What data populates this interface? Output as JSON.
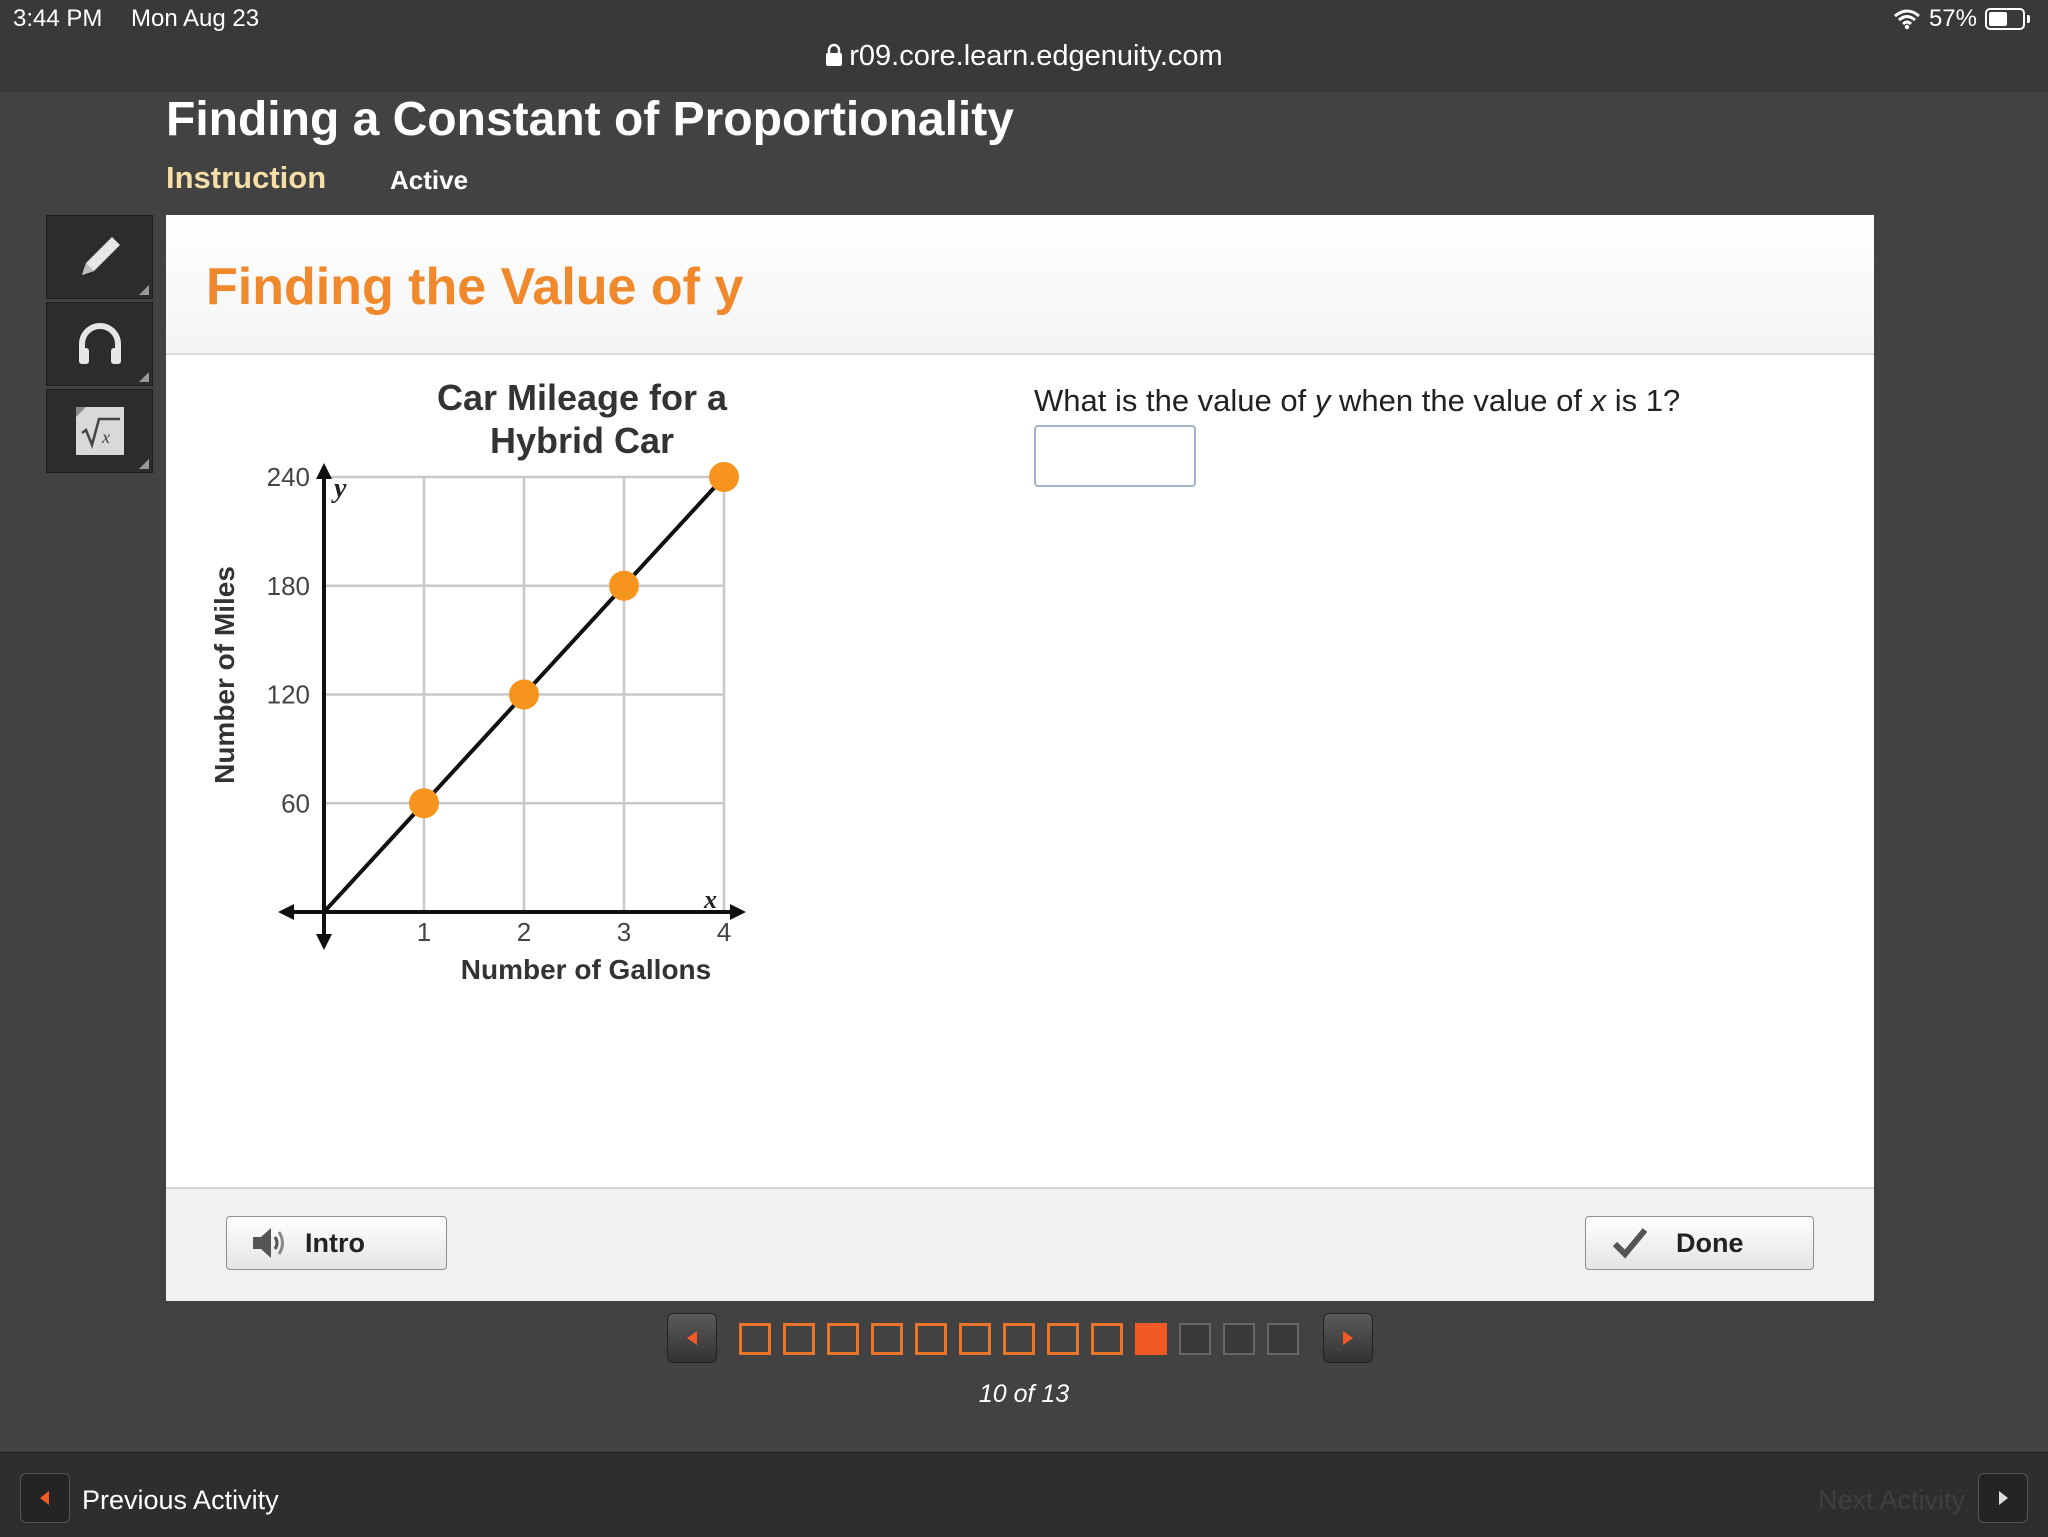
{
  "status_bar": {
    "time": "3:44 PM",
    "date": "Mon Aug 23",
    "battery": "57%",
    "url": "r09.core.learn.edgenuity.com"
  },
  "header": {
    "lesson_title": "Finding a Constant of Proportionality",
    "tab_instruction": "Instruction",
    "tab_active": "Active"
  },
  "toolbar": {
    "icons": [
      "pencil-icon",
      "headphones-icon",
      "calculator-icon"
    ]
  },
  "panel": {
    "title": "Finding the Value of y",
    "question": {
      "prefix": "What is the value of ",
      "var_y": "y",
      "middle": " when the value of ",
      "var_x": "x",
      "suffix": " is 1?"
    },
    "answer_value": "",
    "intro_label": "Intro",
    "done_label": "Done"
  },
  "chart_data": {
    "type": "line",
    "title_line1": "Car Mileage for a",
    "title_line2": "Hybrid Car",
    "xlabel": "Number of Gallons",
    "ylabel": "Number of Miles",
    "x_axis_var": "x",
    "y_axis_var": "y",
    "x_ticks": [
      "1",
      "2",
      "3",
      "4"
    ],
    "y_ticks": [
      "60",
      "120",
      "180",
      "240"
    ],
    "xlim": [
      0,
      4
    ],
    "ylim": [
      0,
      240
    ],
    "grid": true,
    "points": [
      {
        "x": 1,
        "y": 60
      },
      {
        "x": 2,
        "y": 120
      },
      {
        "x": 3,
        "y": 180
      },
      {
        "x": 4,
        "y": 240
      }
    ],
    "line_color": "#111111",
    "point_color": "#f7941d"
  },
  "pagination": {
    "current": 10,
    "total": 13,
    "label": "10 of 13",
    "active_color": "#f15a24",
    "done_color": "#e8752a"
  },
  "bottom_bar": {
    "previous_label": "Previous Activity",
    "next_label": "Next Activity"
  }
}
